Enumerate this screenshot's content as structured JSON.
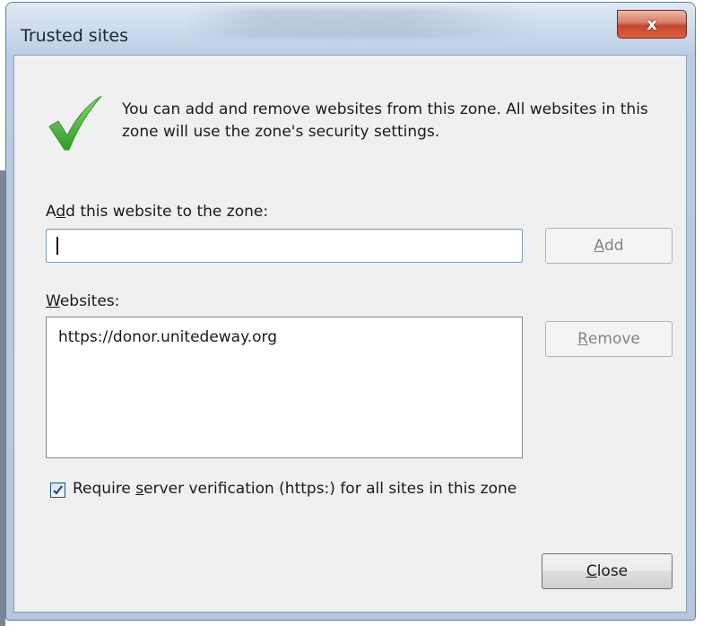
{
  "window": {
    "title": "Trusted sites",
    "close_glyph": "x"
  },
  "info": {
    "icon": "green-checkmark-icon",
    "text": "You can add and remove websites from this zone. All websites in this zone will use the zone's security settings."
  },
  "add_section": {
    "label_prefix": "A",
    "label_mnemonic": "d",
    "label_rest": "d this website to the zone:",
    "input_value": "",
    "add_button_mnemonic": "A",
    "add_button_rest": "dd"
  },
  "websites_section": {
    "label_mnemonic": "W",
    "label_rest": "ebsites:",
    "items": [
      "https://donor.unitedeway.org"
    ],
    "remove_button_mnemonic": "R",
    "remove_button_rest": "emove"
  },
  "verification": {
    "checked": true,
    "label_prefix": "Require ",
    "label_mnemonic": "s",
    "label_rest": "erver verification (https:) for all sites in this zone"
  },
  "footer": {
    "close_mnemonic": "C",
    "close_rest": "lose"
  },
  "colors": {
    "accent_green": "#3fae3a",
    "close_red": "#c4452b"
  }
}
